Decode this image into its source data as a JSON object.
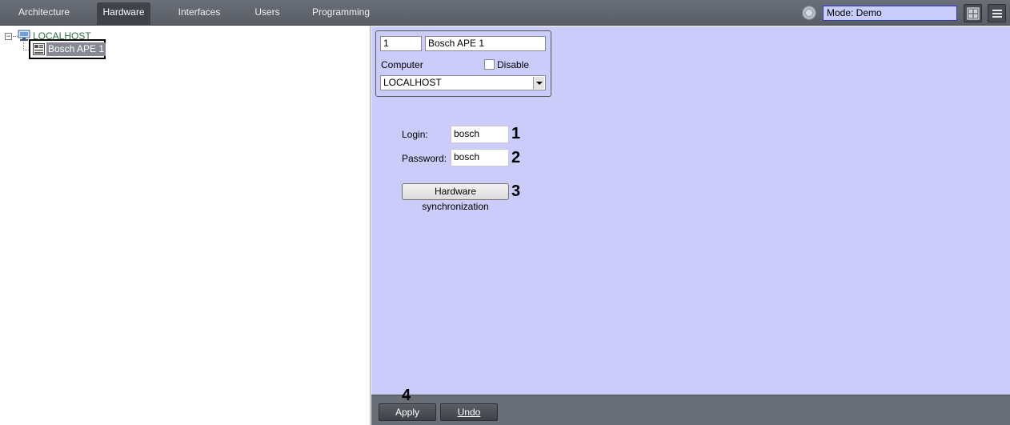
{
  "nav": {
    "tabs": [
      {
        "label": "Architecture"
      },
      {
        "label": "Hardware",
        "active": true
      },
      {
        "label": "Interfaces"
      },
      {
        "label": "Users"
      },
      {
        "label": "Programming"
      }
    ],
    "mode": "Mode: Demo"
  },
  "tree": {
    "root_label": "LOCALHOST",
    "root_expander": "−",
    "child_label": "Bosch APE 1"
  },
  "object": {
    "id": "1",
    "name": "Bosch APE 1",
    "computer_label": "Computer",
    "disable_label": "Disable",
    "disable_checked": false,
    "computer_value": "LOCALHOST"
  },
  "settings": {
    "login_label": "Login:",
    "login_value": "bosch",
    "password_label": "Password:",
    "password_value": "bosch",
    "sync_button": "Hardware synchronization"
  },
  "callouts": [
    "1",
    "2",
    "3",
    "4"
  ],
  "footer": {
    "apply": "Apply",
    "undo": "Undo"
  },
  "colors": {
    "panel_bg": "#ccccfa",
    "topbar_bg": "#5f636b",
    "tree_label": "#2c7040",
    "selection_bg": "#868994"
  }
}
